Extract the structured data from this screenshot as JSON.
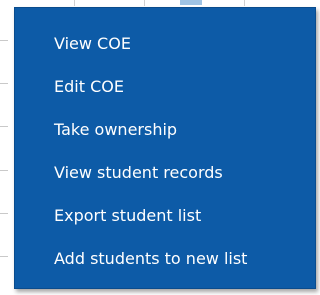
{
  "context_menu": {
    "items": [
      {
        "label": "View COE"
      },
      {
        "label": "Edit COE"
      },
      {
        "label": "Take ownership"
      },
      {
        "label": "View student records"
      },
      {
        "label": "Export student list"
      },
      {
        "label": "Add students to new list"
      }
    ]
  },
  "colors": {
    "menu_background": "#0d5ba7",
    "menu_text": "#ffffff",
    "accent_top": "#9fc3e4"
  }
}
